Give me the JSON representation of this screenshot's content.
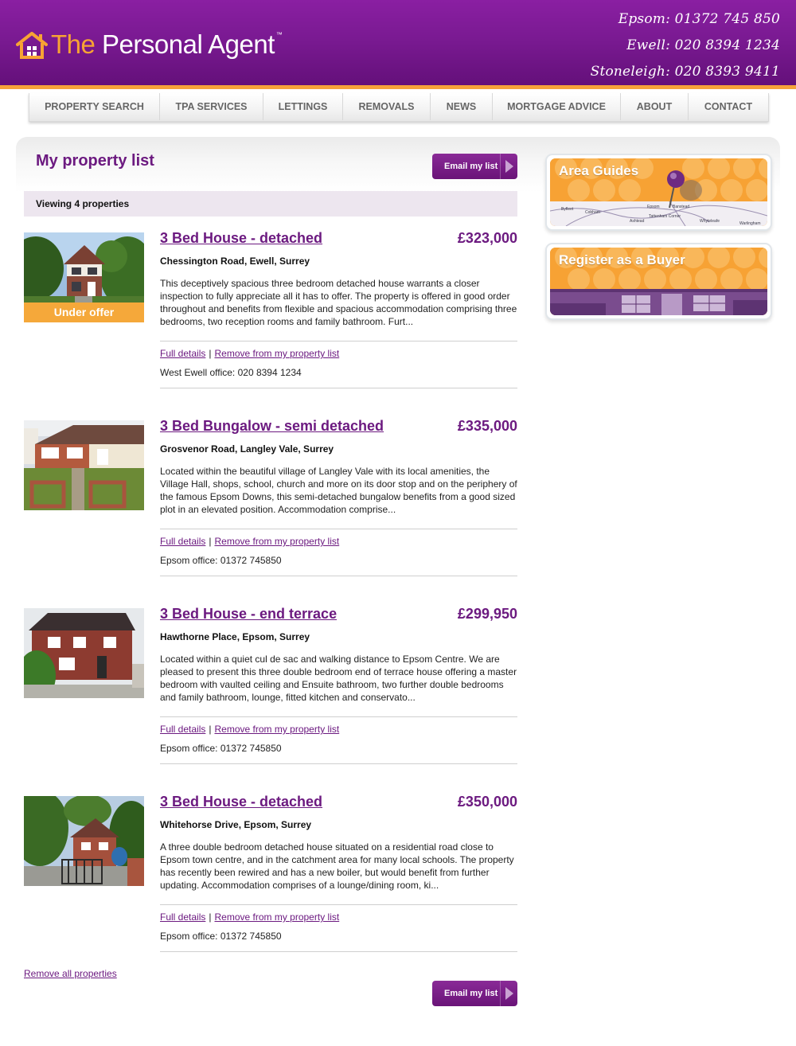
{
  "header": {
    "logo_the": "The",
    "logo_rest": " Personal Agent",
    "logo_tm": "™",
    "phones": [
      "Epsom: 01372 745 850",
      "Ewell: 020 8394 1234",
      "Stoneleigh: 020 8393 9411"
    ]
  },
  "nav": {
    "items": [
      "PROPERTY SEARCH",
      "TPA SERVICES",
      "LETTINGS",
      "REMOVALS",
      "NEWS",
      "MORTGAGE ADVICE",
      "ABOUT",
      "CONTACT"
    ]
  },
  "main": {
    "title": "My property list",
    "email_button": "Email my list",
    "viewing_text": "Viewing 4 properties",
    "link_full_details": "Full details",
    "link_separator": "|",
    "link_remove": "Remove from my property list",
    "remove_all": "Remove all properties",
    "listings": [
      {
        "title": "3 Bed House - detached",
        "price": "£323,000",
        "address": "Chessington Road, Ewell, Surrey",
        "description": "This deceptively spacious three bedroom detached house warrants a closer inspection to fully appreciate all it has to offer. The property is offered in good order throughout and benefits from flexible and spacious accommodation comprising three bedrooms, two reception rooms and family bathroom. Furt...",
        "office": "West Ewell office: 020 8394 1234",
        "badge": "Under offer"
      },
      {
        "title": "3 Bed Bungalow - semi detached",
        "price": "£335,000",
        "address": "Grosvenor Road, Langley Vale, Surrey",
        "description": "Located within the beautiful village of Langley Vale with its local amenities, the Village Hall, shops, school, church and more on its door stop and on the periphery of the famous Epsom Downs, this semi-detached bungalow benefits from a good sized plot in an elevated position. Accommodation comprise...",
        "office": "Epsom office: 01372 745850"
      },
      {
        "title": "3 Bed House - end terrace",
        "price": "£299,950",
        "address": "Hawthorne Place, Epsom, Surrey",
        "description": "Located within a quiet cul de sac and walking distance to Epsom Centre. We are pleased to present this three double bedroom end of terrace house offering a master bedroom with vaulted ceiling and Ensuite bathroom, two further double bedrooms and family bathroom, lounge, fitted kitchen and conservato...",
        "office": "Epsom office: 01372 745850"
      },
      {
        "title": "3 Bed House - detached",
        "price": "£350,000",
        "address": "Whitehorse Drive, Epsom, Surrey",
        "description": "A three double bedroom detached house situated on a residential road close to Epsom town centre, and in the catchment area for many local schools. The property has recently been rewired and has a new boiler, but would benefit from further updating. Accommodation comprises of a lounge/dining room, ki...",
        "office": "Epsom office: 01372 745850"
      }
    ]
  },
  "sidebar": {
    "area_guides": {
      "title": "Area Guides",
      "map_labels": [
        "Byfleet",
        "Cobham",
        "Ashtead",
        "Epsom",
        "Tattenham Corner",
        "Banstead",
        "Whyteleafe",
        "Warlingham"
      ]
    },
    "register": {
      "title": "Register as a Buyer"
    }
  },
  "colors": {
    "brand_purple": "#6c1a80",
    "header_purple": "#7a1a92",
    "accent_orange": "#f5a33a",
    "viewing_bar": "#ede6ef"
  }
}
